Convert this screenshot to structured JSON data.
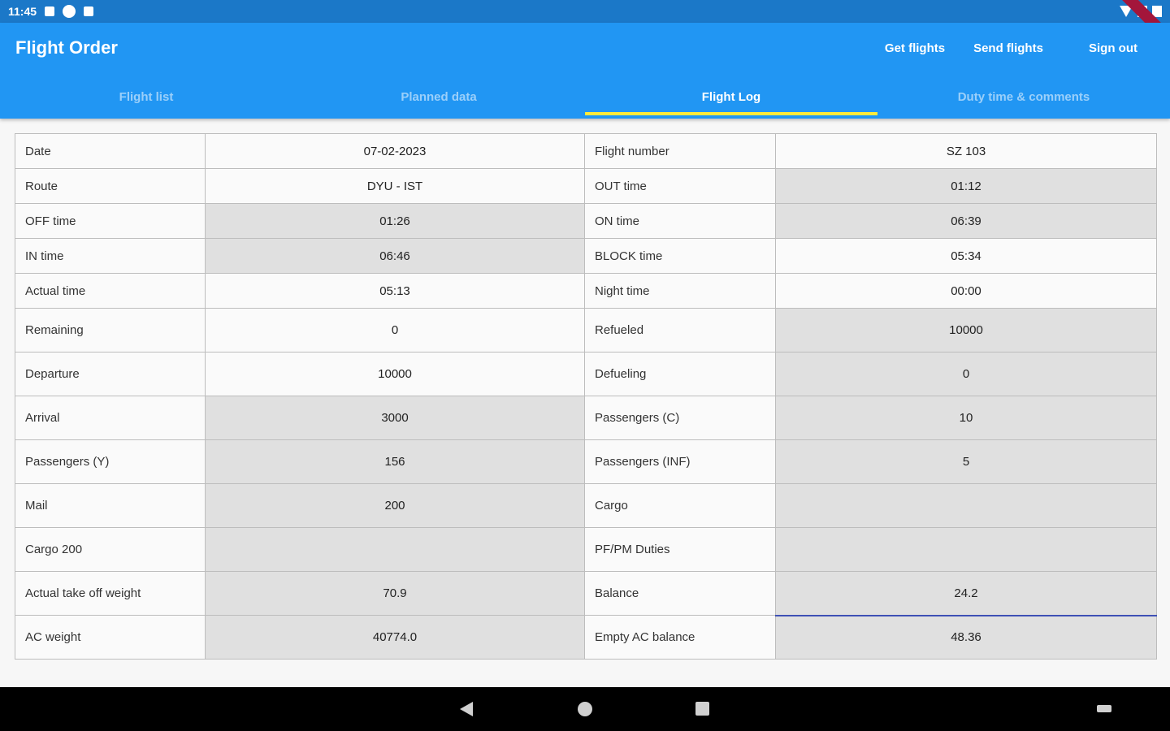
{
  "status_bar": {
    "time": "11:45"
  },
  "app": {
    "title": "Flight Order"
  },
  "actions": [
    {
      "label": "Get flights"
    },
    {
      "label": "Send flights"
    },
    {
      "label": "Sign out"
    }
  ],
  "tabs": [
    {
      "label": "Flight list"
    },
    {
      "label": "Planned data"
    },
    {
      "label": "Flight Log"
    },
    {
      "label": "Duty time & comments"
    }
  ],
  "active_tab": "Flight Log",
  "rows": [
    {
      "l1": "Date",
      "v1": "07-02-2023",
      "l2": "Flight number",
      "v2": "SZ 103"
    },
    {
      "l1": "Route",
      "v1": "DYU - IST",
      "l2": "OUT time",
      "v2": "01:12"
    },
    {
      "l1": "OFF time",
      "v1": "01:26",
      "l2": "ON time",
      "v2": "06:39"
    },
    {
      "l1": "IN time",
      "v1": "06:46",
      "l2": "BLOCK time",
      "v2": "05:34"
    },
    {
      "l1": "Actual time",
      "v1": "05:13",
      "l2": "Night time",
      "v2": "00:00"
    },
    {
      "l1": "Remaining",
      "v1": "0",
      "l2": "Refueled",
      "v2": "10000"
    },
    {
      "l1": "Departure",
      "v1": "10000",
      "l2": "Defueling",
      "v2": "0"
    },
    {
      "l1": "Arrival",
      "v1": "3000",
      "l2": "Passengers (C)",
      "v2": "10"
    },
    {
      "l1": "Passengers (Y)",
      "v1": "156",
      "l2": "Passengers (INF)",
      "v2": "5"
    },
    {
      "l1": "Mail",
      "v1": "200",
      "l2": "Cargo",
      "v2": ""
    },
    {
      "l1": "Cargo 200",
      "v1": "",
      "l2": "PF/PM Duties",
      "v2": ""
    },
    {
      "l1": "Actual take off weight",
      "v1": "70.9",
      "l2": "Balance",
      "v2": "24.2"
    },
    {
      "l1": "AC weight",
      "v1": "40774.0",
      "l2": "Empty AC balance",
      "v2": "48.36"
    }
  ]
}
